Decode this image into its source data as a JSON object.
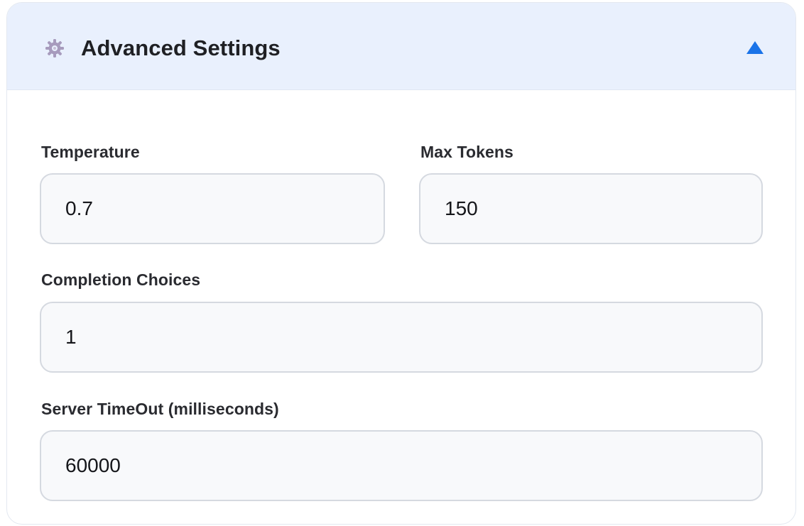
{
  "section": {
    "title": "Advanced Settings",
    "icon": "gear-icon",
    "toggle_icon": "collapse-arrow-up-icon",
    "expanded": true,
    "accent_color": "#1a73e8"
  },
  "fields": {
    "temperature": {
      "label": "Temperature",
      "value": "0.7"
    },
    "max_tokens": {
      "label": "Max Tokens",
      "value": "150"
    },
    "completion_choices": {
      "label": "Completion Choices",
      "value": "1"
    },
    "server_timeout": {
      "label": "Server TimeOut (milliseconds)",
      "value": "60000"
    }
  }
}
